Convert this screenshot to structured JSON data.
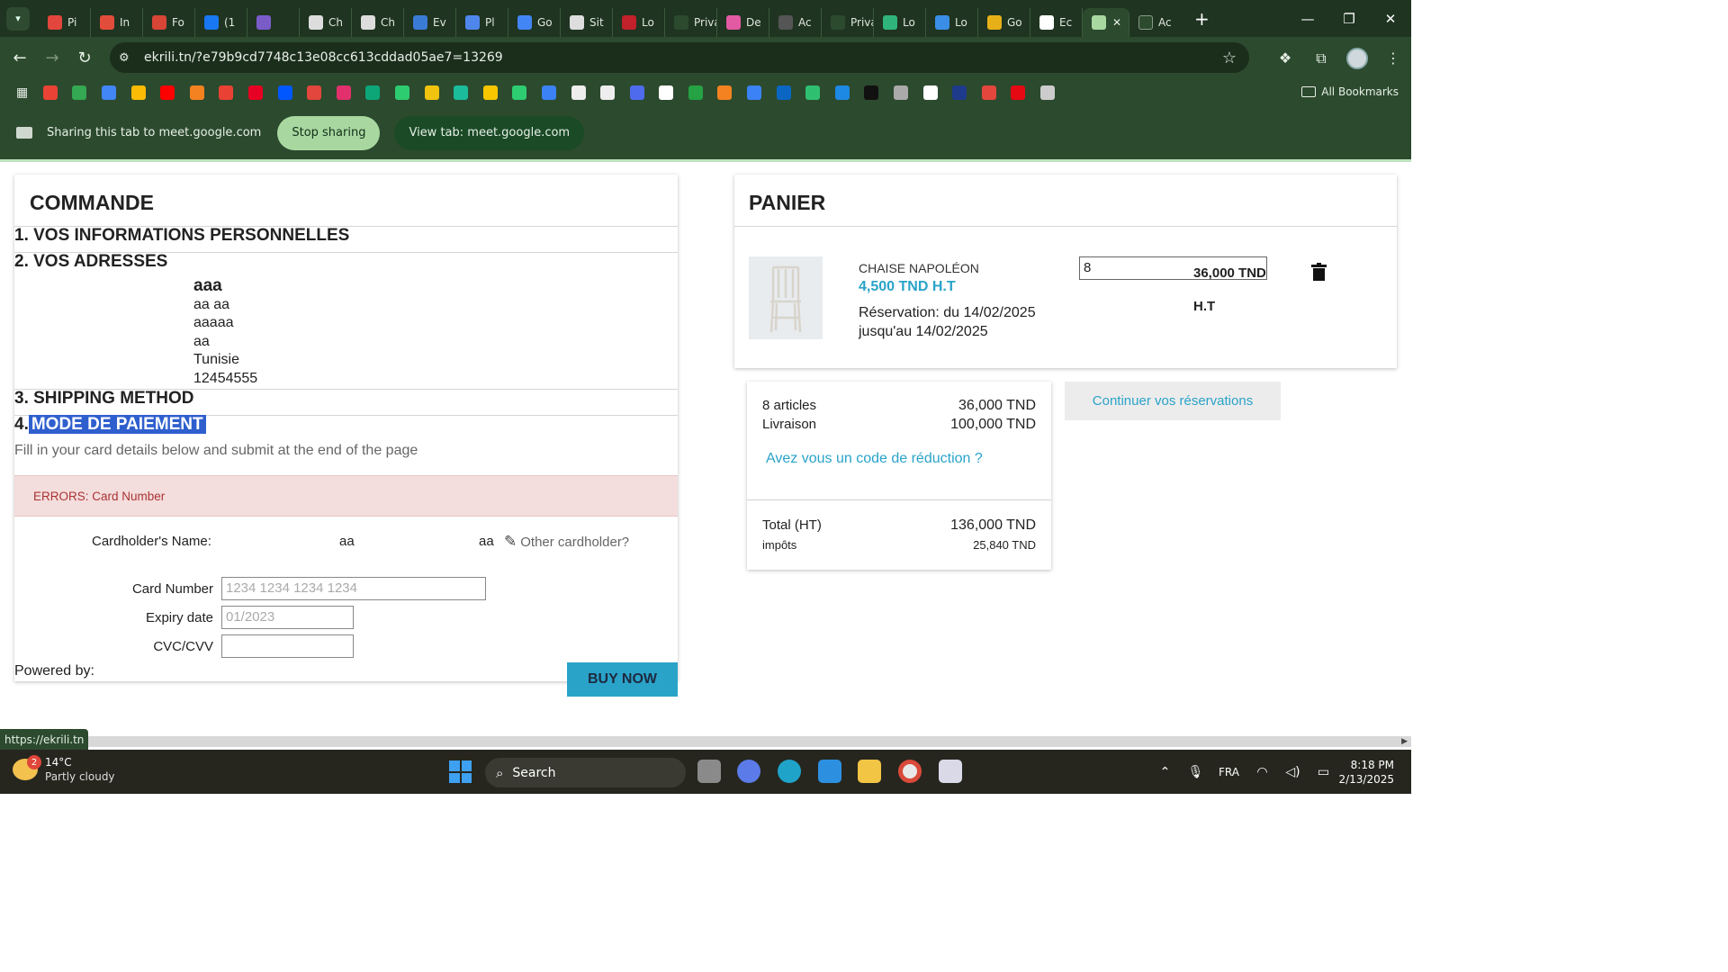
{
  "browser": {
    "tabs": [
      {
        "label": "Pi",
        "color": "#e2463c"
      },
      {
        "label": "In",
        "color": "#e24c3b"
      },
      {
        "label": "Fo",
        "color": "#d64536"
      },
      {
        "label": "(1",
        "color": "#1877f2"
      },
      {
        "label": "",
        "color": "#7a5cc9"
      },
      {
        "label": "Ch",
        "color": "#dddddd"
      },
      {
        "label": "Ch",
        "color": "#dddddd"
      },
      {
        "label": "Ev",
        "color": "#3a7bd5"
      },
      {
        "label": "Pl",
        "color": "#4f86ec"
      },
      {
        "label": "Go",
        "color": "#4285f4"
      },
      {
        "label": "Sit",
        "color": "#dddddd"
      },
      {
        "label": "Lo",
        "color": "#c0212a"
      },
      {
        "label": "Privacy",
        "color": "#2c4a2e"
      },
      {
        "label": "De",
        "color": "#e25aa1"
      },
      {
        "label": "Ac",
        "color": "#555555"
      },
      {
        "label": "Privacy",
        "color": "#2c4a2e"
      },
      {
        "label": "Lo",
        "color": "#2fb47c"
      },
      {
        "label": "Lo",
        "color": "#3a8ee6"
      },
      {
        "label": "Go",
        "color": "#e8b018"
      },
      {
        "label": "Ec",
        "color": "#ffffff"
      }
    ],
    "active_tab_close": "✕",
    "trailing_tab_label": "Ac",
    "new_tab": "+",
    "url": "ekrili.tn/?e79b9cd7748c13e08cc613cddad05ae7=13269",
    "bookmarks": [
      "#ea4335",
      "#34a853",
      "#4285f4",
      "#fbbc05",
      "#ff0000",
      "#f58220",
      "#e94235",
      "#e60023",
      "#0057ff",
      "#e2463c",
      "#e1306c",
      "#0ca678",
      "#2ecc71",
      "#f1c40f",
      "#1abc9c",
      "#f7c600",
      "#2ecc71",
      "#3b82f6",
      "#eeeeee",
      "#eeeeee",
      "#4f6bed",
      "#ffffff",
      "#25a244",
      "#f58220",
      "#3b82f6",
      "#0a66c2",
      "#2fbf71",
      "#1e88e5",
      "#111111",
      "#aaaaaa",
      "#ffffff",
      "#1e3a8a",
      "#e2463c",
      "#e50914",
      "#cccccc"
    ],
    "all_bookmarks": "All Bookmarks",
    "sharing_text": "Sharing this tab to meet.google.com",
    "stop_sharing": "Stop sharing",
    "view_tab": "View tab: meet.google.com",
    "status_link": "https://ekrili.tn"
  },
  "order": {
    "title": "COMMANDE",
    "section1": "1. VOS INFORMATIONS PERSONNELLES",
    "section2": "2. VOS ADRESSES",
    "address": {
      "name": "aaa",
      "line1": "aa aa",
      "line2": "aaaaa",
      "line3": "aa",
      "country": "Tunisie",
      "phone": "12454555"
    },
    "section3": "3. SHIPPING METHOD",
    "section4_num": "4.",
    "section4_label": "MODE DE PAIEMENT",
    "hint": "Fill in your card details below and submit at the end of the page",
    "error": "ERRORS: Card Number",
    "cardholder_label": "Cardholder's Name:",
    "cardholder_first": "aa",
    "cardholder_last": "aa",
    "other_cardholder": "Other cardholder?",
    "card_number_label": "Card Number",
    "card_number_placeholder": "1234 1234 1234 1234",
    "expiry_label": "Expiry date",
    "expiry_placeholder": "01/2023",
    "cvc_label": "CVC/CVV",
    "powered_by": "Powered by:",
    "buy_now": "BUY NOW"
  },
  "cart": {
    "title": "PANIER",
    "item": {
      "name": "CHAISE NAPOLÉON",
      "unit_price": "4,500 TND H.T",
      "reservation_line1": "Réservation: du 14/02/2025",
      "reservation_line2": "jusqu'au 14/02/2025",
      "quantity": "8",
      "line_total": "36,000 TND",
      "line_total_suffix": "H.T"
    },
    "summary": {
      "articles_label": "8 articles",
      "articles_value": "36,000 TND",
      "delivery_label": "Livraison",
      "delivery_value": "100,000 TND",
      "discount_link": "Avez vous un code de réduction ?",
      "total_label": "Total (HT)",
      "total_value": "136,000 TND",
      "tax_label": "impôts",
      "tax_value": "25,840 TND"
    },
    "continue_button": "Continuer vos réservations"
  },
  "taskbar": {
    "weather_badge": "2",
    "temperature": "14°C",
    "weather": "Partly cloudy",
    "search": "Search",
    "language": "FRA",
    "time": "8:18 PM",
    "date": "2/13/2025"
  }
}
